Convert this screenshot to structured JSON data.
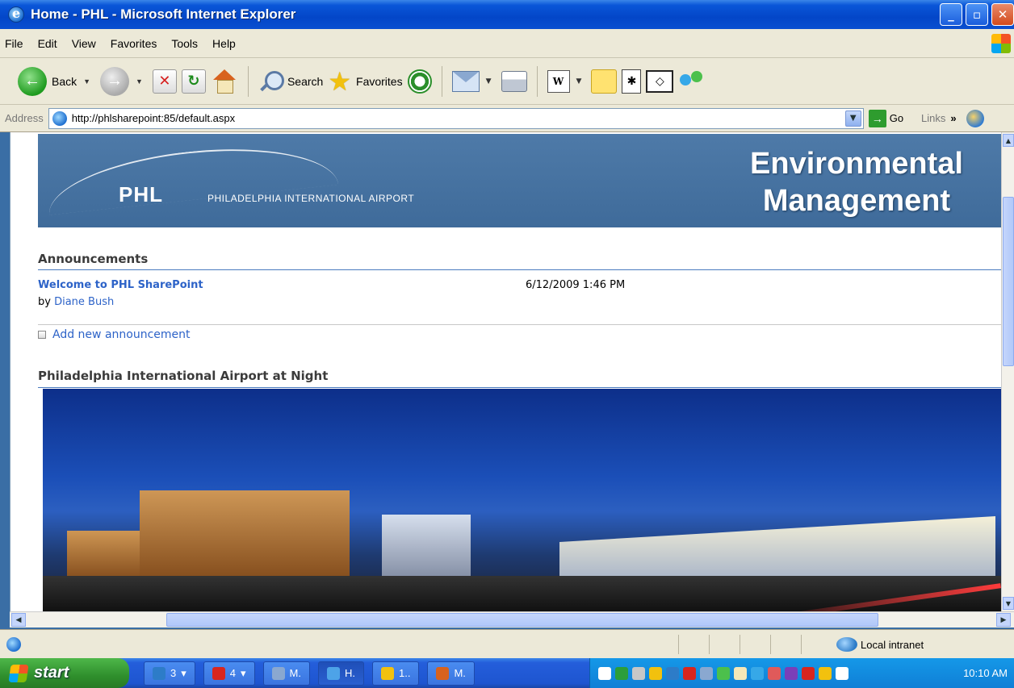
{
  "window": {
    "title": "Home - PHL - Microsoft Internet Explorer",
    "buttons": {
      "minimize": "_",
      "maximize": "▫",
      "close": "✕"
    }
  },
  "menu": {
    "items": [
      "File",
      "Edit",
      "View",
      "Favorites",
      "Tools",
      "Help"
    ]
  },
  "toolbar": {
    "back": "Back",
    "search": "Search",
    "favorites": "Favorites"
  },
  "address": {
    "label": "Address",
    "url": "http://phlsharepoint:85/default.aspx",
    "go": "Go",
    "links": "Links",
    "links_chevron": "»"
  },
  "banner": {
    "logo": "PHL",
    "logo_sub": "PHILADELPHIA INTERNATIONAL AIRPORT",
    "title_line1": "Environmental",
    "title_line2": "Management"
  },
  "announcements": {
    "heading": "Announcements",
    "items": [
      {
        "title": "Welcome to PHL SharePoint",
        "by_prefix": "by",
        "author": "Diane Bush",
        "date": "6/12/2009 1:46 PM"
      }
    ],
    "add_link": "Add new announcement"
  },
  "image_webpart": {
    "heading": "Philadelphia International Airport at Night"
  },
  "status": {
    "zone": "Local intranet"
  },
  "taskbar": {
    "start": "start",
    "buttons": [
      {
        "label": "3",
        "color": "#2d7cc8"
      },
      {
        "label": "4",
        "color": "#d8261e"
      },
      {
        "label": "M.",
        "color": "#8aa8d0"
      },
      {
        "label": "H.",
        "color": "#4da3e8"
      },
      {
        "label": "1..",
        "color": "#f2c10e"
      },
      {
        "label": "M.",
        "color": "#d8621e"
      }
    ],
    "clock": "10:10 AM"
  },
  "colors": {
    "link": "#2d63c8",
    "rule": "#4a7bbf",
    "titlebar": "#0a56d8"
  }
}
